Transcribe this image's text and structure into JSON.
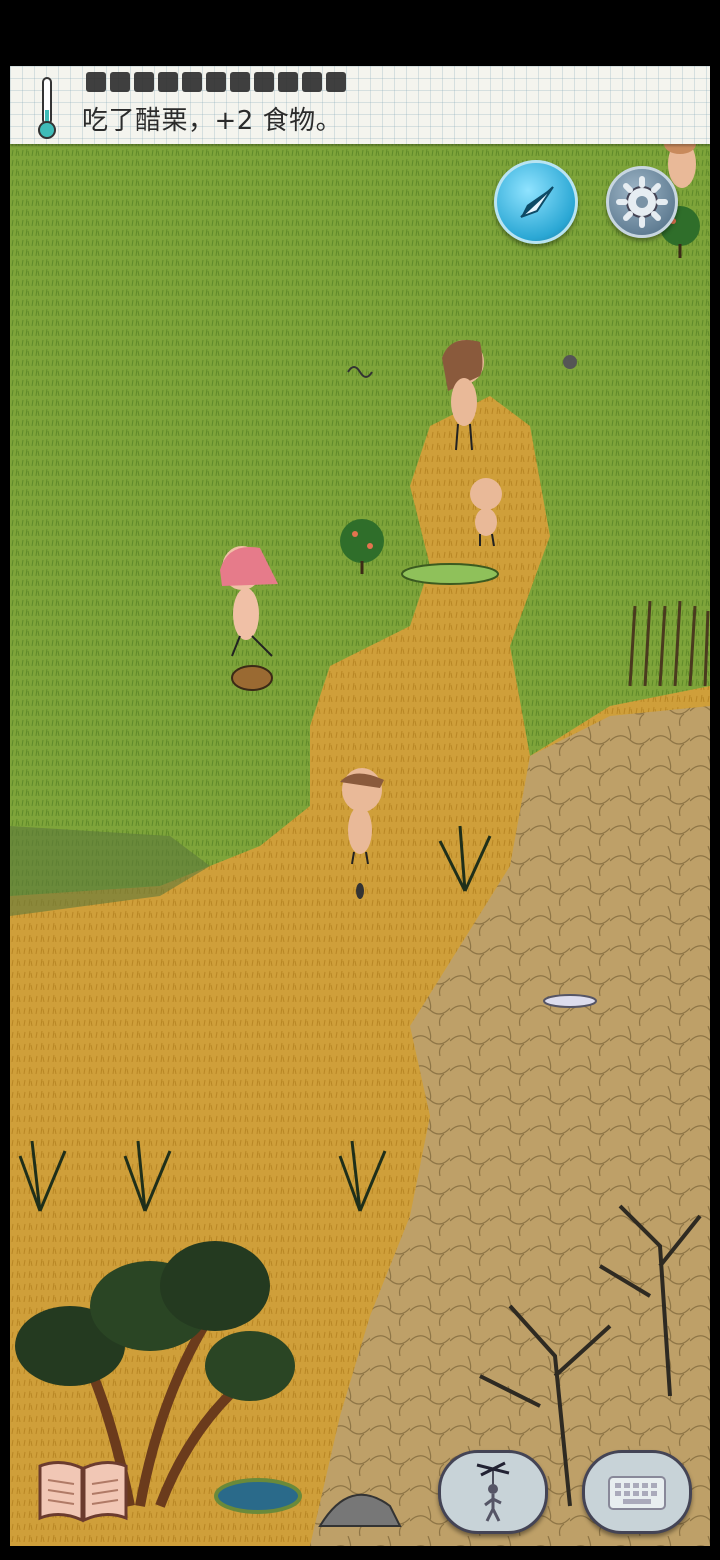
{
  "status": {
    "message": "吃了醋栗，+2 食物。",
    "food_pips": 11
  },
  "icons": {
    "thermometer": "thermometer-icon",
    "compass": "compass-icon",
    "settings": "gear-icon",
    "book": "book-icon",
    "puppet": "puppet-icon",
    "keyboard": "keyboard-icon"
  },
  "colors": {
    "grass": "#7fa73a",
    "dry_path": "#cf9f3a",
    "dirt": "#b89a62",
    "accent_blue": "#2aa7d4"
  }
}
